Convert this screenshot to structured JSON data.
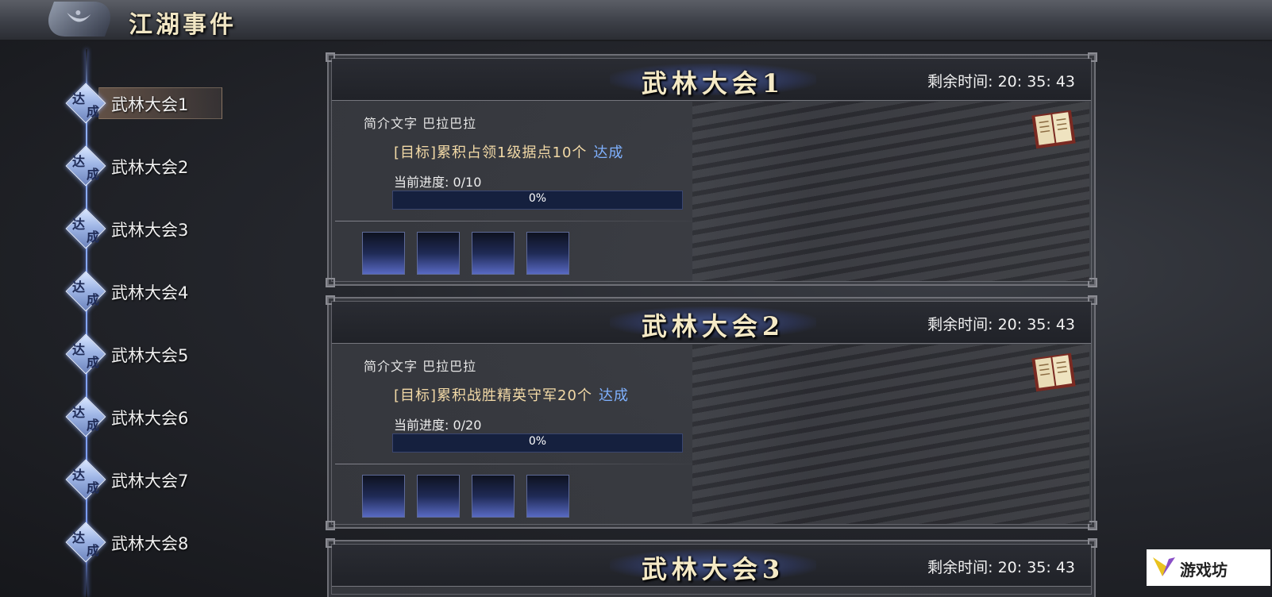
{
  "header": {
    "title": "江湖事件",
    "logo_icon": "crescent-moon-icon"
  },
  "sidebar": {
    "badge_char_1": "达",
    "badge_char_2": "成",
    "items": [
      {
        "label": "武林大会1"
      },
      {
        "label": "武林大会2"
      },
      {
        "label": "武林大会3"
      },
      {
        "label": "武林大会4"
      },
      {
        "label": "武林大会5"
      },
      {
        "label": "武林大会6"
      },
      {
        "label": "武林大会7"
      },
      {
        "label": "武林大会8"
      }
    ],
    "active_index": 0
  },
  "events": [
    {
      "title": "武林大会1",
      "timer_label": "剩余时间:",
      "timer_value": "20: 35: 43",
      "intro": "简介文字 巴拉巴拉",
      "goal": "[目标]累积占领1级据点10个",
      "goal_status": "达成",
      "progress_label": "当前进度: 0/10",
      "progress_percent": 0,
      "progress_text": "0%",
      "reward_slots": 4
    },
    {
      "title": "武林大会2",
      "timer_label": "剩余时间:",
      "timer_value": "20: 35: 43",
      "intro": "简介文字 巴拉巴拉",
      "goal": "[目标]累积战胜精英守军20个",
      "goal_status": "达成",
      "progress_label": "当前进度: 0/20",
      "progress_percent": 0,
      "progress_text": "0%",
      "reward_slots": 4
    },
    {
      "title": "武林大会3",
      "timer_label": "剩余时间:",
      "timer_value": "20: 35: 43"
    }
  ],
  "watermark": {
    "text": "游戏坊"
  },
  "colors": {
    "title_gold": "#f4e9c5",
    "goal_text": "#f2d9a6",
    "done_blue": "#7fb1ff",
    "progress_bg": "#15203e"
  }
}
